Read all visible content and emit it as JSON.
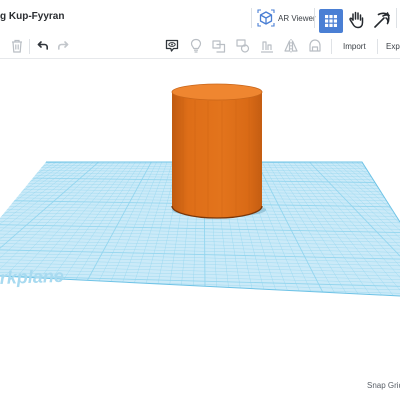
{
  "header": {
    "title": "g Kup-Fyyran",
    "ar_viewer_label": "AR Viewer"
  },
  "toolbar": {
    "import_label": "Import",
    "export_label": "Expo"
  },
  "workplane": {
    "label": "rkplane",
    "grid_color": "#8fd4ee",
    "plane_color": "#cbeaf8"
  },
  "shape": {
    "type": "cylinder",
    "color": "#e0701a"
  },
  "status": {
    "snap_grid_label": "Snap Grid"
  },
  "icons": {
    "ar": "ar-cube-icon",
    "grid_view": "grid-view-icon",
    "hand": "hand-icon",
    "pickaxe": "pickaxe-icon",
    "trash": "trash-icon",
    "undo": "undo-icon",
    "redo": "redo-icon",
    "comment": "comment-icon",
    "bulb": "light-bulb-icon",
    "shape": "shape-icon",
    "group": "group-icon",
    "align": "align-icon",
    "mirror": "mirror-icon",
    "cruise": "cruise-icon"
  }
}
